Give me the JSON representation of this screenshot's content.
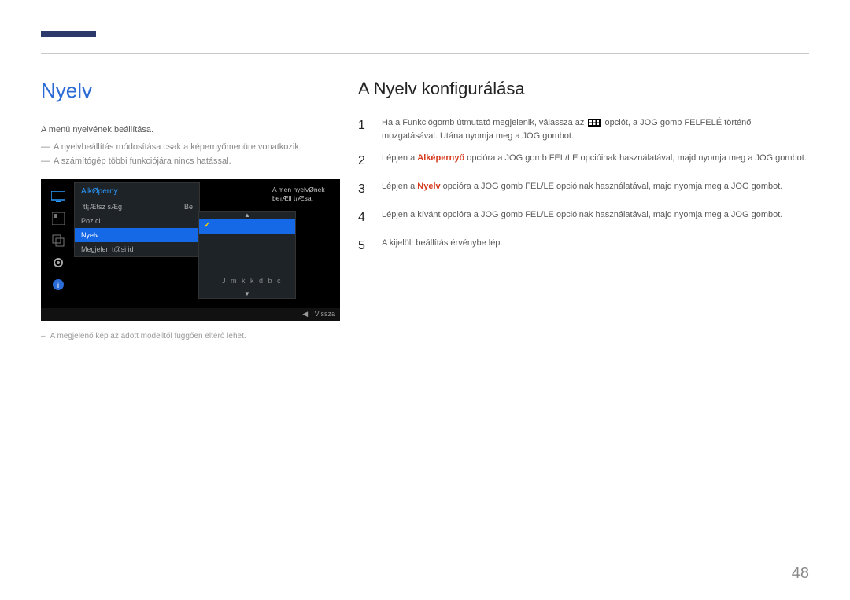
{
  "page_number": "48",
  "left": {
    "heading": "Nyelv",
    "description": "A menü nyelvének beállítása.",
    "notes": [
      "A nyelvbeállítás módosítása csak a képernyőmenüre vonatkozik.",
      "A számítógép többi funkciójára nincs hatással."
    ],
    "footnote": "A megjelenő kép az adott modelltől függően eltérő lehet.",
    "osd": {
      "menu_title": "AlkØperny",
      "items": [
        {
          "label": "`tl¡Ætsz sÆg",
          "value": "Be"
        },
        {
          "label": "Poz ci",
          "value": ""
        },
        {
          "label": "Nyelv",
          "value": ""
        },
        {
          "label": "Megjelen t@si id",
          "value": ""
        }
      ],
      "hint": "A men  nyelvØnek be¡Æll t¡Æsa.",
      "sub_hint": "J m k k d b c",
      "bottom_label": "Vissza"
    }
  },
  "right": {
    "heading": "A Nyelv konfigurálása",
    "steps": [
      {
        "num": "1",
        "pre": "Ha a Funkciógomb útmutató megjelenik, válassza az ",
        "icon": "grid",
        "post": " opciót, a JOG gomb FELFELÉ történő mozgatásával. Utána nyomja meg a JOG gombot."
      },
      {
        "num": "2",
        "pre": "Lépjen a ",
        "hl": "Alképernyő",
        "post": " opcióra a JOG gomb FEL/LE opcióinak használatával, majd nyomja meg a JOG gombot."
      },
      {
        "num": "3",
        "pre": "Lépjen a ",
        "hl": "Nyelv",
        "post": " opcióra a JOG gomb FEL/LE opcióinak használatával, majd nyomja meg a JOG gombot."
      },
      {
        "num": "4",
        "pre": "Lépjen a kívánt opcióra a JOG gomb FEL/LE opcióinak használatával, majd nyomja meg a JOG gombot.",
        "hl": "",
        "post": ""
      },
      {
        "num": "5",
        "pre": "A kijelölt beállítás érvénybe lép.",
        "hl": "",
        "post": ""
      }
    ]
  }
}
